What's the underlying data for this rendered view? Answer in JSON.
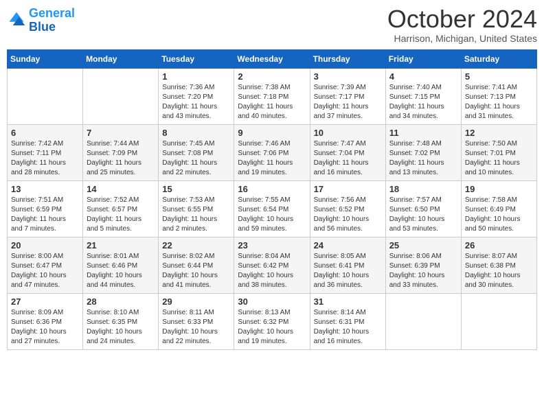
{
  "logo": {
    "line1": "General",
    "line2": "Blue"
  },
  "header": {
    "month": "October 2024",
    "location": "Harrison, Michigan, United States"
  },
  "weekdays": [
    "Sunday",
    "Monday",
    "Tuesday",
    "Wednesday",
    "Thursday",
    "Friday",
    "Saturday"
  ],
  "weeks": [
    [
      {
        "day": "",
        "sunrise": "",
        "sunset": "",
        "daylight": ""
      },
      {
        "day": "",
        "sunrise": "",
        "sunset": "",
        "daylight": ""
      },
      {
        "day": "1",
        "sunrise": "Sunrise: 7:36 AM",
        "sunset": "Sunset: 7:20 PM",
        "daylight": "Daylight: 11 hours and 43 minutes."
      },
      {
        "day": "2",
        "sunrise": "Sunrise: 7:38 AM",
        "sunset": "Sunset: 7:18 PM",
        "daylight": "Daylight: 11 hours and 40 minutes."
      },
      {
        "day": "3",
        "sunrise": "Sunrise: 7:39 AM",
        "sunset": "Sunset: 7:17 PM",
        "daylight": "Daylight: 11 hours and 37 minutes."
      },
      {
        "day": "4",
        "sunrise": "Sunrise: 7:40 AM",
        "sunset": "Sunset: 7:15 PM",
        "daylight": "Daylight: 11 hours and 34 minutes."
      },
      {
        "day": "5",
        "sunrise": "Sunrise: 7:41 AM",
        "sunset": "Sunset: 7:13 PM",
        "daylight": "Daylight: 11 hours and 31 minutes."
      }
    ],
    [
      {
        "day": "6",
        "sunrise": "Sunrise: 7:42 AM",
        "sunset": "Sunset: 7:11 PM",
        "daylight": "Daylight: 11 hours and 28 minutes."
      },
      {
        "day": "7",
        "sunrise": "Sunrise: 7:44 AM",
        "sunset": "Sunset: 7:09 PM",
        "daylight": "Daylight: 11 hours and 25 minutes."
      },
      {
        "day": "8",
        "sunrise": "Sunrise: 7:45 AM",
        "sunset": "Sunset: 7:08 PM",
        "daylight": "Daylight: 11 hours and 22 minutes."
      },
      {
        "day": "9",
        "sunrise": "Sunrise: 7:46 AM",
        "sunset": "Sunset: 7:06 PM",
        "daylight": "Daylight: 11 hours and 19 minutes."
      },
      {
        "day": "10",
        "sunrise": "Sunrise: 7:47 AM",
        "sunset": "Sunset: 7:04 PM",
        "daylight": "Daylight: 11 hours and 16 minutes."
      },
      {
        "day": "11",
        "sunrise": "Sunrise: 7:48 AM",
        "sunset": "Sunset: 7:02 PM",
        "daylight": "Daylight: 11 hours and 13 minutes."
      },
      {
        "day": "12",
        "sunrise": "Sunrise: 7:50 AM",
        "sunset": "Sunset: 7:01 PM",
        "daylight": "Daylight: 11 hours and 10 minutes."
      }
    ],
    [
      {
        "day": "13",
        "sunrise": "Sunrise: 7:51 AM",
        "sunset": "Sunset: 6:59 PM",
        "daylight": "Daylight: 11 hours and 7 minutes."
      },
      {
        "day": "14",
        "sunrise": "Sunrise: 7:52 AM",
        "sunset": "Sunset: 6:57 PM",
        "daylight": "Daylight: 11 hours and 5 minutes."
      },
      {
        "day": "15",
        "sunrise": "Sunrise: 7:53 AM",
        "sunset": "Sunset: 6:55 PM",
        "daylight": "Daylight: 11 hours and 2 minutes."
      },
      {
        "day": "16",
        "sunrise": "Sunrise: 7:55 AM",
        "sunset": "Sunset: 6:54 PM",
        "daylight": "Daylight: 10 hours and 59 minutes."
      },
      {
        "day": "17",
        "sunrise": "Sunrise: 7:56 AM",
        "sunset": "Sunset: 6:52 PM",
        "daylight": "Daylight: 10 hours and 56 minutes."
      },
      {
        "day": "18",
        "sunrise": "Sunrise: 7:57 AM",
        "sunset": "Sunset: 6:50 PM",
        "daylight": "Daylight: 10 hours and 53 minutes."
      },
      {
        "day": "19",
        "sunrise": "Sunrise: 7:58 AM",
        "sunset": "Sunset: 6:49 PM",
        "daylight": "Daylight: 10 hours and 50 minutes."
      }
    ],
    [
      {
        "day": "20",
        "sunrise": "Sunrise: 8:00 AM",
        "sunset": "Sunset: 6:47 PM",
        "daylight": "Daylight: 10 hours and 47 minutes."
      },
      {
        "day": "21",
        "sunrise": "Sunrise: 8:01 AM",
        "sunset": "Sunset: 6:46 PM",
        "daylight": "Daylight: 10 hours and 44 minutes."
      },
      {
        "day": "22",
        "sunrise": "Sunrise: 8:02 AM",
        "sunset": "Sunset: 6:44 PM",
        "daylight": "Daylight: 10 hours and 41 minutes."
      },
      {
        "day": "23",
        "sunrise": "Sunrise: 8:04 AM",
        "sunset": "Sunset: 6:42 PM",
        "daylight": "Daylight: 10 hours and 38 minutes."
      },
      {
        "day": "24",
        "sunrise": "Sunrise: 8:05 AM",
        "sunset": "Sunset: 6:41 PM",
        "daylight": "Daylight: 10 hours and 36 minutes."
      },
      {
        "day": "25",
        "sunrise": "Sunrise: 8:06 AM",
        "sunset": "Sunset: 6:39 PM",
        "daylight": "Daylight: 10 hours and 33 minutes."
      },
      {
        "day": "26",
        "sunrise": "Sunrise: 8:07 AM",
        "sunset": "Sunset: 6:38 PM",
        "daylight": "Daylight: 10 hours and 30 minutes."
      }
    ],
    [
      {
        "day": "27",
        "sunrise": "Sunrise: 8:09 AM",
        "sunset": "Sunset: 6:36 PM",
        "daylight": "Daylight: 10 hours and 27 minutes."
      },
      {
        "day": "28",
        "sunrise": "Sunrise: 8:10 AM",
        "sunset": "Sunset: 6:35 PM",
        "daylight": "Daylight: 10 hours and 24 minutes."
      },
      {
        "day": "29",
        "sunrise": "Sunrise: 8:11 AM",
        "sunset": "Sunset: 6:33 PM",
        "daylight": "Daylight: 10 hours and 22 minutes."
      },
      {
        "day": "30",
        "sunrise": "Sunrise: 8:13 AM",
        "sunset": "Sunset: 6:32 PM",
        "daylight": "Daylight: 10 hours and 19 minutes."
      },
      {
        "day": "31",
        "sunrise": "Sunrise: 8:14 AM",
        "sunset": "Sunset: 6:31 PM",
        "daylight": "Daylight: 10 hours and 16 minutes."
      },
      {
        "day": "",
        "sunrise": "",
        "sunset": "",
        "daylight": ""
      },
      {
        "day": "",
        "sunrise": "",
        "sunset": "",
        "daylight": ""
      }
    ]
  ]
}
